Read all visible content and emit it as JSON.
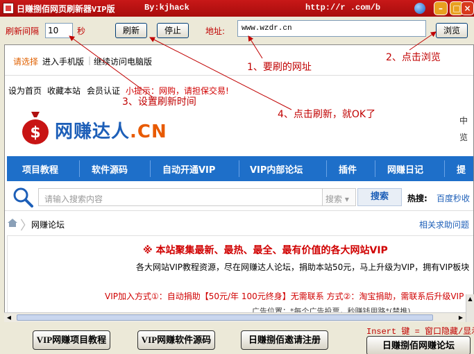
{
  "titlebar": {
    "title": "日赚捌佰网页刷新器VIP版",
    "author": "By:kjhack",
    "url_fragment": "http://r        .com/b"
  },
  "toolbar": {
    "interval_label": "刷新间隔",
    "interval_value": "10",
    "interval_unit": "秒",
    "refresh_label": "刷新",
    "stop_label": "停止",
    "url_label": "地址:",
    "url_value": "www.wzdr.cn",
    "browse_label": "浏览"
  },
  "webpage": {
    "choose_label": "请选择",
    "mobile_link": "进入手机版",
    "desktop_link": "继续访问电脑版",
    "toplinks": [
      "设为首页",
      "收藏本站",
      "会员认证"
    ],
    "tip": "小提示：网购，请担保交易!",
    "logo_main": "网赚达人",
    "logo_suffix": ".CN",
    "nav": [
      "项目教程",
      "软件源码",
      "自动开通VIP",
      "VIP内部论坛",
      "插件",
      "网赚日记",
      "提"
    ],
    "search_placeholder": "请输入搜索内容",
    "search_select": "搜索",
    "search_button": "搜索",
    "hot_label": "热搜:",
    "hot_item": "百度秒收",
    "breadcrumb": "网赚论坛",
    "related_link": "相关求助问题",
    "headline": "※ 本站聚集最新、最热、最全、最有价值的各大网站VIP",
    "subline": "各大网站VIP教程资源，尽在网赚达人论坛，捐助本站50元，马上升级为VIP，拥有VIP板块",
    "vip_line": "VIP加入方式①：自动捐助【50元/年 100元终身】无需联系 方式②：淘宝捐助，需联系后升级VIP",
    "ad_line": "广告位置：*每个广告投票，秒赚钱用路*(禁推)",
    "edge_char": "中",
    "edge_char2": "览"
  },
  "bottom": {
    "btn1": "VIP网赚项目教程",
    "btn2": "VIP网赚软件源码",
    "btn3": "日赚捌佰邀请注册",
    "btn4": "日赚捌佰网赚论坛",
    "hint": "Insert 键 = 窗口隐藏/显示"
  },
  "annotations": {
    "a1": "1、要刷的网址",
    "a2": "2、点击浏览",
    "a3": "3、设置刷新时间",
    "a4": "4、点击刷新，就OK了"
  },
  "colors": {
    "accent_red": "#c00000",
    "nav_blue": "#1e6fc9",
    "title_red": "#b81212"
  }
}
